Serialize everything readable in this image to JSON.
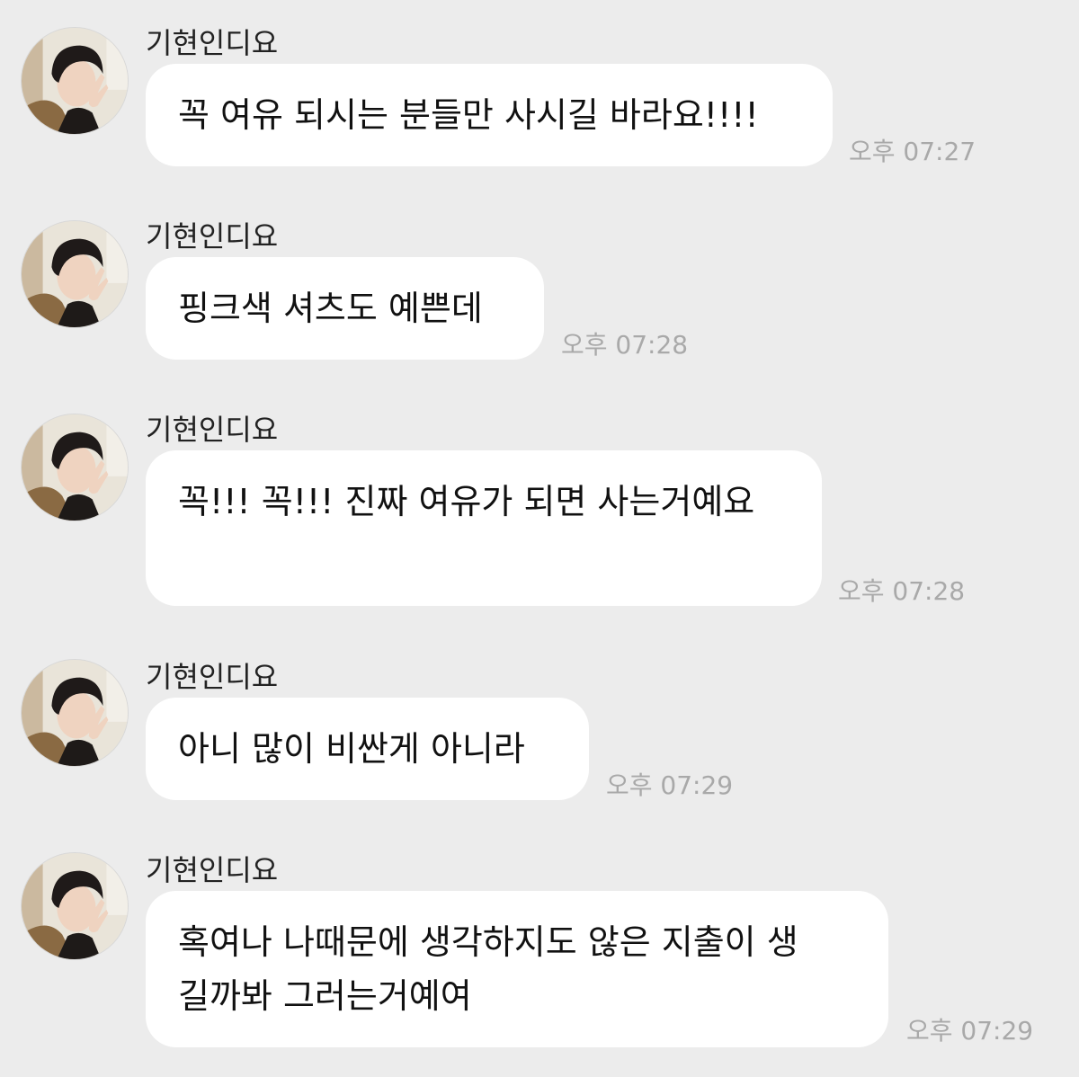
{
  "chat": {
    "messages": [
      {
        "sender": "기현인디요",
        "lines": [
          "꼭 여유 되시는 분들만 사시길 바라요!!!!"
        ],
        "time": "오후 07:27"
      },
      {
        "sender": "기현인디요",
        "lines": [
          "핑크색 셔츠도 예쁜데"
        ],
        "time": "오후 07:28"
      },
      {
        "sender": "기현인디요",
        "lines": [
          "꼭!!! 꼭!!! 진짜 여유가 되면 사는거예요"
        ],
        "time": "오후 07:28"
      },
      {
        "sender": "기현인디요",
        "lines": [
          "아니 많이 비싼게 아니라"
        ],
        "time": "오후 07:29"
      },
      {
        "sender": "기현인디요",
        "lines": [
          "혹여나 나때문에 생각하지도 않은 지출이 생",
          "길까봐 그러는거예여"
        ],
        "time": "오후 07:29"
      }
    ]
  },
  "colors": {
    "background": "#ececec",
    "bubble": "#ffffff",
    "sender_text": "#222222",
    "message_text": "#111111",
    "time_text": "#a9a9a9"
  },
  "icons": {
    "avatar": "profile-photo"
  }
}
